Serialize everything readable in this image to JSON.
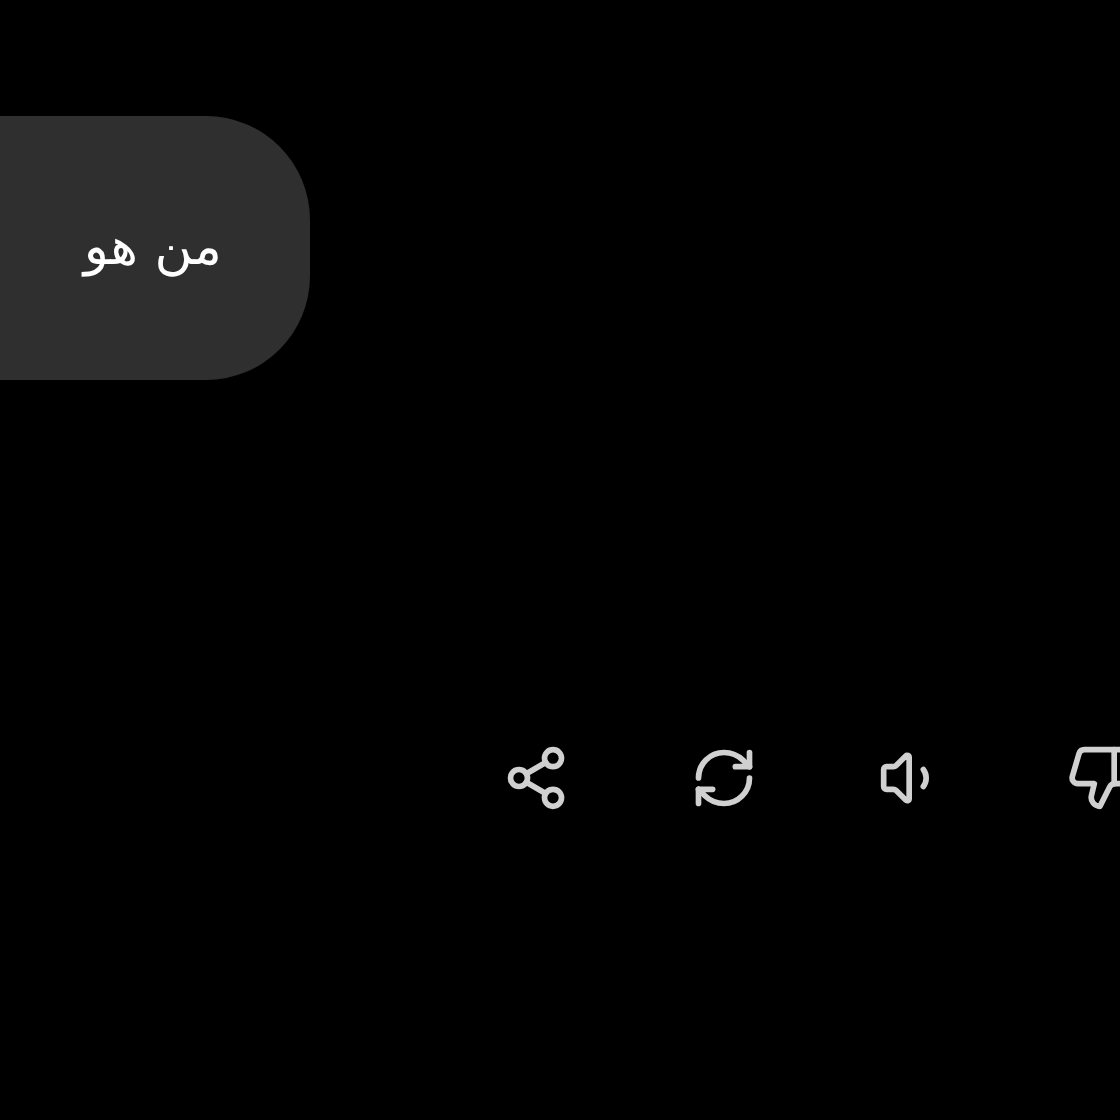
{
  "message": {
    "text": "من هو"
  },
  "actions": [
    {
      "kind": "share"
    },
    {
      "kind": "regenerate"
    },
    {
      "kind": "read_aloud"
    },
    {
      "kind": "dislike"
    }
  ]
}
